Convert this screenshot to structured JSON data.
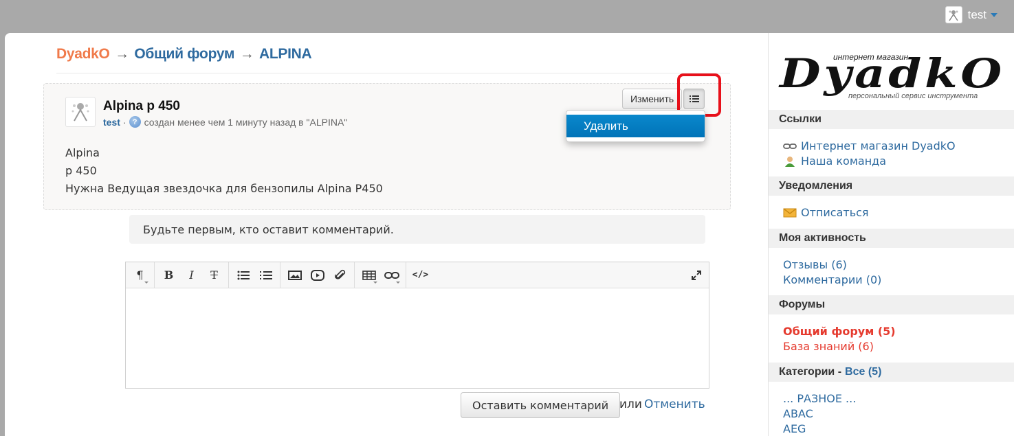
{
  "user": {
    "name": "test"
  },
  "breadcrumb": {
    "home": "DyadkO",
    "sep": "→",
    "forum": "Общий форум",
    "topic": "ALPINA"
  },
  "topic": {
    "title": "Alpina p 450",
    "author": "test",
    "meta": "создан менее чем 1 минуту назад в \"ALPINA\"",
    "body": [
      "Alpina",
      "p 450",
      "Нужна Ведущая звездочка для бензопилы Alpina P450"
    ],
    "edit_label": "Изменить",
    "menu": {
      "delete_label": "Удалить"
    }
  },
  "comments": {
    "empty_text": "Будьте первым, кто оставит комментарий."
  },
  "editor": {
    "toolbar": [
      "paragraph",
      "bold",
      "italic",
      "strikethrough",
      "unordered-list",
      "ordered-list",
      "image",
      "video",
      "file",
      "table",
      "link",
      "code",
      "fullscreen"
    ]
  },
  "actions": {
    "submit_label": "Оставить комментарий",
    "or_text": "или",
    "cancel_label": "Отменить"
  },
  "sidebar": {
    "logo": {
      "tagline_top": "интернет магазин",
      "brand": "DyadkO",
      "tagline_bottom": "персональный сервис инструмента"
    },
    "links_title": "Ссылки",
    "links": [
      "Интернет магазин DyadkO",
      "Наша команда"
    ],
    "notifications_title": "Уведомления",
    "unsubscribe": "Отписаться",
    "activity_title": "Моя активность",
    "activity": [
      "Отзывы (6)",
      "Комментарии (0)"
    ],
    "forums_title": "Форумы",
    "forums": [
      "Общий форум (5)",
      "База знаний (6)"
    ],
    "categories_title": "Категории -",
    "categories_all": "Все (5)",
    "categories": [
      "... РАЗНОЕ ...",
      "ABAC",
      "AEG"
    ]
  },
  "colors": {
    "accent": "#2e6a9f",
    "home": "#f07a4a",
    "highlight": "#e8101a",
    "forum_active": "#e53a2e"
  }
}
